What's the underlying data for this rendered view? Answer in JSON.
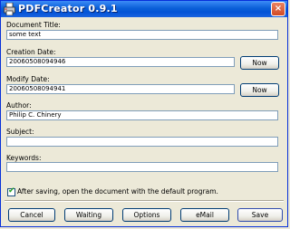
{
  "window": {
    "title": "PDFCreator 0.9.1",
    "close_glyph": "×"
  },
  "fields": {
    "document_title": {
      "label": "Document Title:",
      "value": "some text"
    },
    "creation_date": {
      "label": "Creation Date:",
      "value": "20060508094946",
      "button": "Now"
    },
    "modify_date": {
      "label": "Modify Date:",
      "value": "20060508094941",
      "button": "Now"
    },
    "author": {
      "label": "Author:",
      "value": "Philip C. Chinery"
    },
    "subject": {
      "label": "Subject:",
      "value": ""
    },
    "keywords": {
      "label": "Keywords:",
      "value": ""
    }
  },
  "options": {
    "open_after_saving": {
      "label": "After saving, open the document with the default program.",
      "checked": true,
      "mark": "✔"
    }
  },
  "buttons": {
    "cancel": "Cancel",
    "waiting": "Waiting",
    "options": "Options",
    "email": "eMail",
    "save": "Save"
  },
  "icons": {
    "app": "pdfcreator-printer-icon",
    "close": "close-icon",
    "check": "checkmark-icon"
  },
  "colors": {
    "titlebar": "#0453d6",
    "window_bg": "#ece9d8",
    "field_border": "#7f9db9",
    "button_border": "#003c74"
  }
}
